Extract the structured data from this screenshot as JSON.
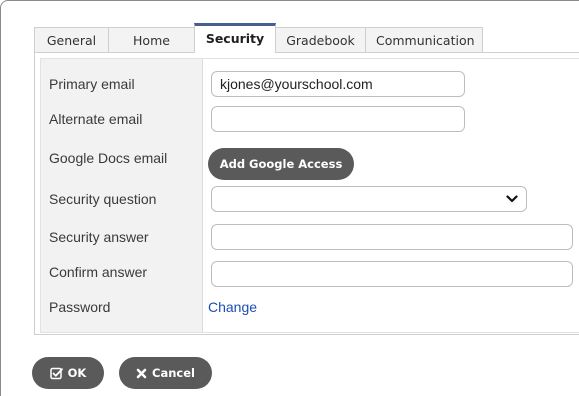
{
  "tabs": [
    {
      "label": "General"
    },
    {
      "label": "Home"
    },
    {
      "label": "Security",
      "active": true
    },
    {
      "label": "Gradebook"
    },
    {
      "label": "Communication"
    }
  ],
  "form": {
    "primary_email": {
      "label": "Primary email",
      "value": "kjones@yourschool.com"
    },
    "alternate_email": {
      "label": "Alternate email",
      "value": ""
    },
    "google_docs_email": {
      "label": "Google Docs email",
      "button_label": "Add Google Access"
    },
    "security_question": {
      "label": "Security question",
      "selected": ""
    },
    "security_answer": {
      "label": "Security answer",
      "value": ""
    },
    "confirm_answer": {
      "label": "Confirm answer",
      "value": ""
    },
    "password": {
      "label": "Password",
      "link_label": "Change"
    }
  },
  "actions": {
    "ok_label": "OK",
    "ok_icon": "checkbox-icon",
    "cancel_label": "Cancel",
    "cancel_icon": "x-icon"
  },
  "colors": {
    "active_tab_accent": "#4a5d93",
    "button_bg": "#5a5a5a",
    "link": "#1d4fb3"
  }
}
